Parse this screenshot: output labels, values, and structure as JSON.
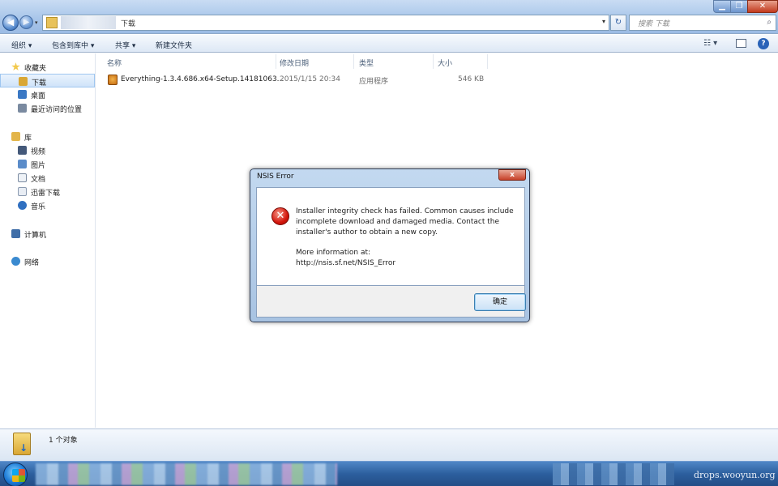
{
  "address": {
    "path": "下载",
    "search_placeholder": "搜索 下载"
  },
  "toolbar": {
    "organize": "组织 ▾",
    "include_library": "包含到库中 ▾",
    "share": "共享 ▾",
    "new_folder": "新建文件夹"
  },
  "sidebar": {
    "favorites": "收藏夹",
    "downloads": "下载",
    "desktop": "桌面",
    "recent": "最近访问的位置",
    "libraries": "库",
    "videos": "视频",
    "pictures": "图片",
    "documents": "文档",
    "xunlei": "迅雷下载",
    "music": "音乐",
    "computer": "计算机",
    "network": "网络"
  },
  "columns": {
    "name": "名称",
    "modified": "修改日期",
    "type": "类型",
    "size": "大小"
  },
  "files": [
    {
      "name": "Everything-1.3.4.686.x64-Setup.14181063...",
      "modified": "2015/1/15 20:34",
      "type": "应用程序",
      "size": "546 KB"
    }
  ],
  "dialog": {
    "title": "NSIS Error",
    "close": "x",
    "message_line1": "Installer integrity check has failed. Common causes include",
    "message_line2": "incomplete download and damaged media. Contact the",
    "message_line3": "installer's author to obtain a new copy.",
    "more_info": "More information at:",
    "url": "http://nsis.sf.net/NSIS_Error",
    "ok": "确定"
  },
  "status": {
    "count": "1 个对象"
  },
  "watermark": "drops.wooyun.org",
  "colors": {
    "error_red": "#d4160c",
    "title_blue": "#a9c6ea",
    "taskbar_blue": "#2c5f9e"
  },
  "icons": [
    "back-icon",
    "forward-icon",
    "folder-icon",
    "refresh-icon",
    "search-icon",
    "star-icon",
    "desktop-icon",
    "recent-icon",
    "library-icon",
    "video-icon",
    "picture-icon",
    "document-icon",
    "download-icon",
    "music-icon",
    "computer-icon",
    "network-icon",
    "installer-icon",
    "error-icon",
    "windows-start-icon"
  ]
}
